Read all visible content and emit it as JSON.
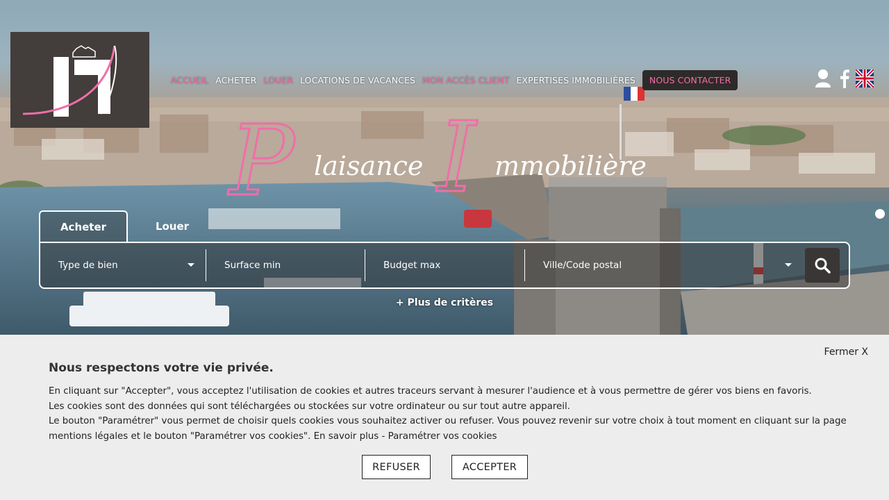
{
  "nav": {
    "items": [
      {
        "label": "ACCUEIL",
        "pink": true
      },
      {
        "label": "ACHETER",
        "pink": false
      },
      {
        "label": "LOUER",
        "pink": true
      },
      {
        "label": "LOCATIONS DE VACANCES",
        "pink": false
      },
      {
        "label": "MON ACCÈS CLIENT",
        "pink": true
      },
      {
        "label": "EXPERTISES IMMOBILIÈRES",
        "pink": false
      }
    ],
    "contact_label": "NOUS CONTACTER"
  },
  "icons": [
    "user-icon",
    "facebook-icon",
    "uk-flag-icon",
    "search-icon",
    "logo"
  ],
  "brand": {
    "word1": "laisance",
    "word2": "mmobilière",
    "letter1": "P",
    "letter2": "I"
  },
  "search": {
    "tabs": [
      "Acheter",
      "Louer"
    ],
    "active_tab": "Acheter",
    "type_placeholder": "Type de bien",
    "surface_placeholder": "Surface min",
    "budget_placeholder": "Budget max",
    "city_placeholder": "Ville/Code postal",
    "more_criteria": "+ Plus de critères"
  },
  "cookie": {
    "close_label": "Fermer X",
    "title": "Nous respectons votre vie privée.",
    "line1": "En cliquant sur \"Accepter\", vous acceptez l'utilisation de cookies et autres traceurs servant à mesurer l'audience et à vous permettre de gérer vos biens en favoris.",
    "line2": "Les cookies sont des données qui sont téléchargées ou stockées sur votre ordinateur ou sur tout autre appareil.",
    "line3": "Le bouton \"Paramétrer\" vous permet de choisir quels cookies vous souhaitez activer ou refuser. Vous pouvez revenir sur votre choix à tout moment en cliquant sur la page mentions légales et le bouton \"Paramétrer vos cookies\". En savoir plus - Paramétrer vos cookies",
    "refuse_label": "REFUSER",
    "accept_label": "ACCEPTER"
  },
  "colors": {
    "pink": "#f06ea8",
    "dark": "#433d3b",
    "cookie_bg": "#ededed"
  }
}
